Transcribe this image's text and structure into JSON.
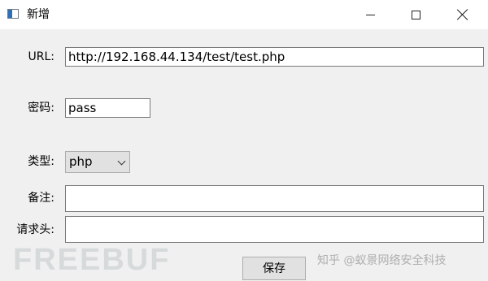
{
  "window": {
    "title": "新增",
    "icon": "app-window-icon",
    "controls": [
      "minimize-icon",
      "maximize-icon",
      "close-icon"
    ]
  },
  "form": {
    "url_label": "URL:",
    "url_value": "http://192.168.44.134/test/test.php",
    "password_label": "密码:",
    "password_value": "pass",
    "type_label": "类型:",
    "type_value": "php",
    "note_label": "备注:",
    "note_value": "",
    "header_label": "请求头:",
    "header_value": "",
    "save_label": "保存"
  },
  "watermarks": {
    "freebuf": "FREEBUF",
    "zhihu": "知乎 @蚁景网络安全科技"
  }
}
